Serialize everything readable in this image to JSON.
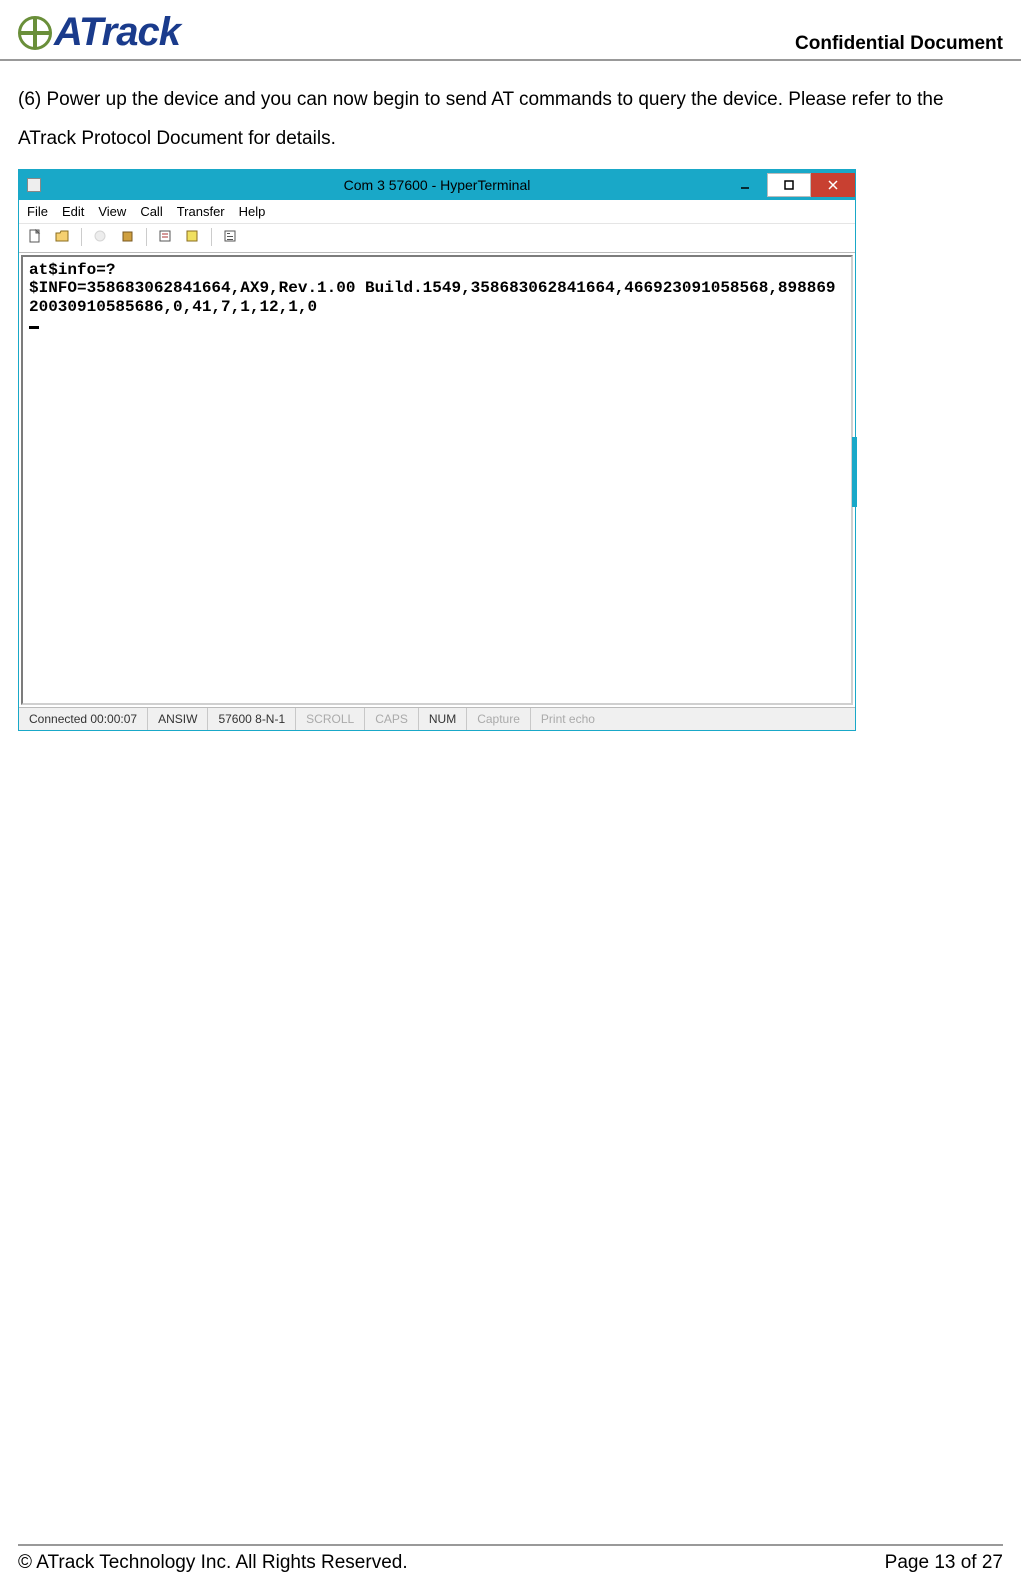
{
  "header": {
    "logo_text": "ATrack",
    "confidential": "Confidential  Document"
  },
  "body": {
    "paragraph": "(6) Power up the device and you can now begin to send AT commands to query the device. Please refer to the ATrack Protocol Document for details."
  },
  "hyperterminal": {
    "title": "Com 3 57600 - HyperTerminal",
    "menu": [
      "File",
      "Edit",
      "View",
      "Call",
      "Transfer",
      "Help"
    ],
    "terminal_lines": "at$info=?\n$INFO=358683062841664,AX9,Rev.1.00 Build.1549,358683062841664,466923091058568,89886920030910585686,0,41,7,1,12,1,0",
    "status": {
      "connected": "Connected 00:00:07",
      "emulation": "ANSIW",
      "settings": "57600 8-N-1",
      "scroll": "SCROLL",
      "caps": "CAPS",
      "num": "NUM",
      "capture": "Capture",
      "print_echo": "Print echo"
    }
  },
  "footer": {
    "copyright": "© ATrack Technology Inc. All Rights Reserved.",
    "page": "Page 13 of 27"
  }
}
